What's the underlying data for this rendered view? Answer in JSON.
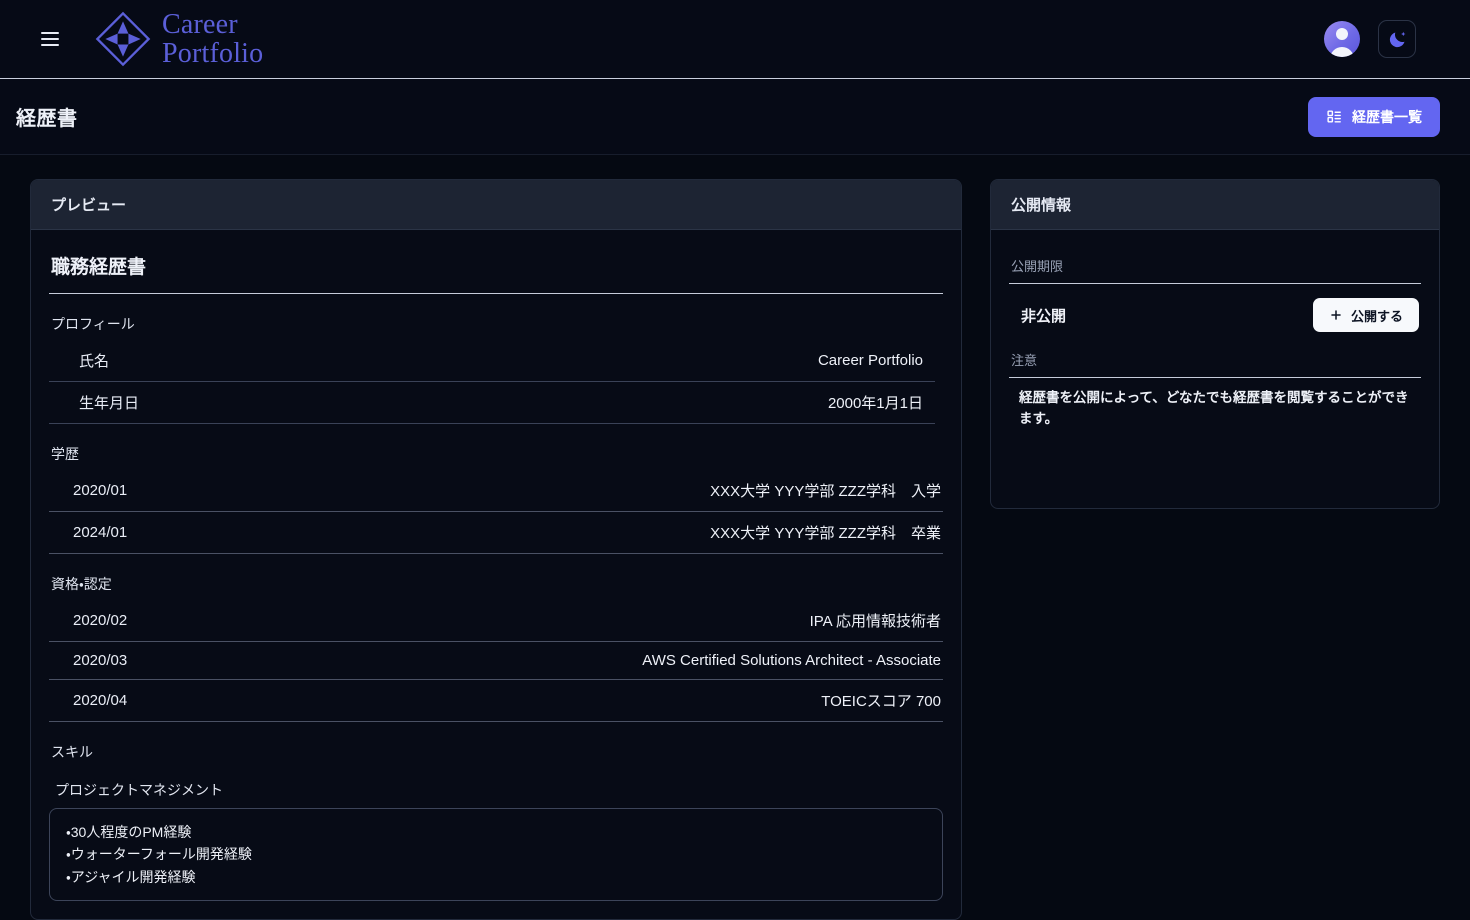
{
  "nav": {
    "menu_icon": "hamburger-icon",
    "brand": {
      "line1": "Career",
      "line2": "Portfolio",
      "logo_icon": "diamond-logo-icon",
      "color": "#5b5fd8"
    },
    "avatar_icon": "user-avatar-icon",
    "theme_toggle_icon": "moon-icon"
  },
  "header": {
    "title": "経歴書",
    "list_button": {
      "label": "経歴書一覧",
      "icon": "view-list-icon",
      "color": "#6366f1"
    }
  },
  "preview": {
    "card_title": "プレビュー",
    "doc_title": "職務経歴書",
    "sections": [
      {
        "label": "プロフィール",
        "rows": [
          {
            "key": "氏名",
            "value": "Career Portfolio"
          },
          {
            "key": "生年月日",
            "value": "2000年1月1日"
          }
        ]
      },
      {
        "label": "学歴",
        "rows": [
          {
            "key": "2020/01",
            "value": "XXX大学 YYY学部 ZZZ学科　入学"
          },
          {
            "key": "2024/01",
            "value": "XXX大学 YYY学部 ZZZ学科　卒業"
          }
        ]
      },
      {
        "label": "資格・認定",
        "rows": [
          {
            "key": "2020/02",
            "value": "IPA 応用情報技術者"
          },
          {
            "key": "2020/03",
            "value": "AWS Certified Solutions Architect - Associate"
          },
          {
            "key": "2020/04",
            "value": "TOEICスコア 700"
          }
        ]
      }
    ],
    "skill_label": "スキル",
    "skill_group": "プロジェクトマネジメント",
    "skill_items": [
      "・30人程度のPM経験",
      "・ウォーターフォール開発経験",
      "・アジャイル開発経験"
    ]
  },
  "publish": {
    "card_title": "公開情報",
    "period_label": "公開期限",
    "status": "非公開",
    "publish_button": {
      "label": "公開する",
      "icon": "plus-icon"
    },
    "notice_label": "注意",
    "notice_text": "経歴書を公開によって、どなたでも経歴書を閲覧することができます。"
  }
}
